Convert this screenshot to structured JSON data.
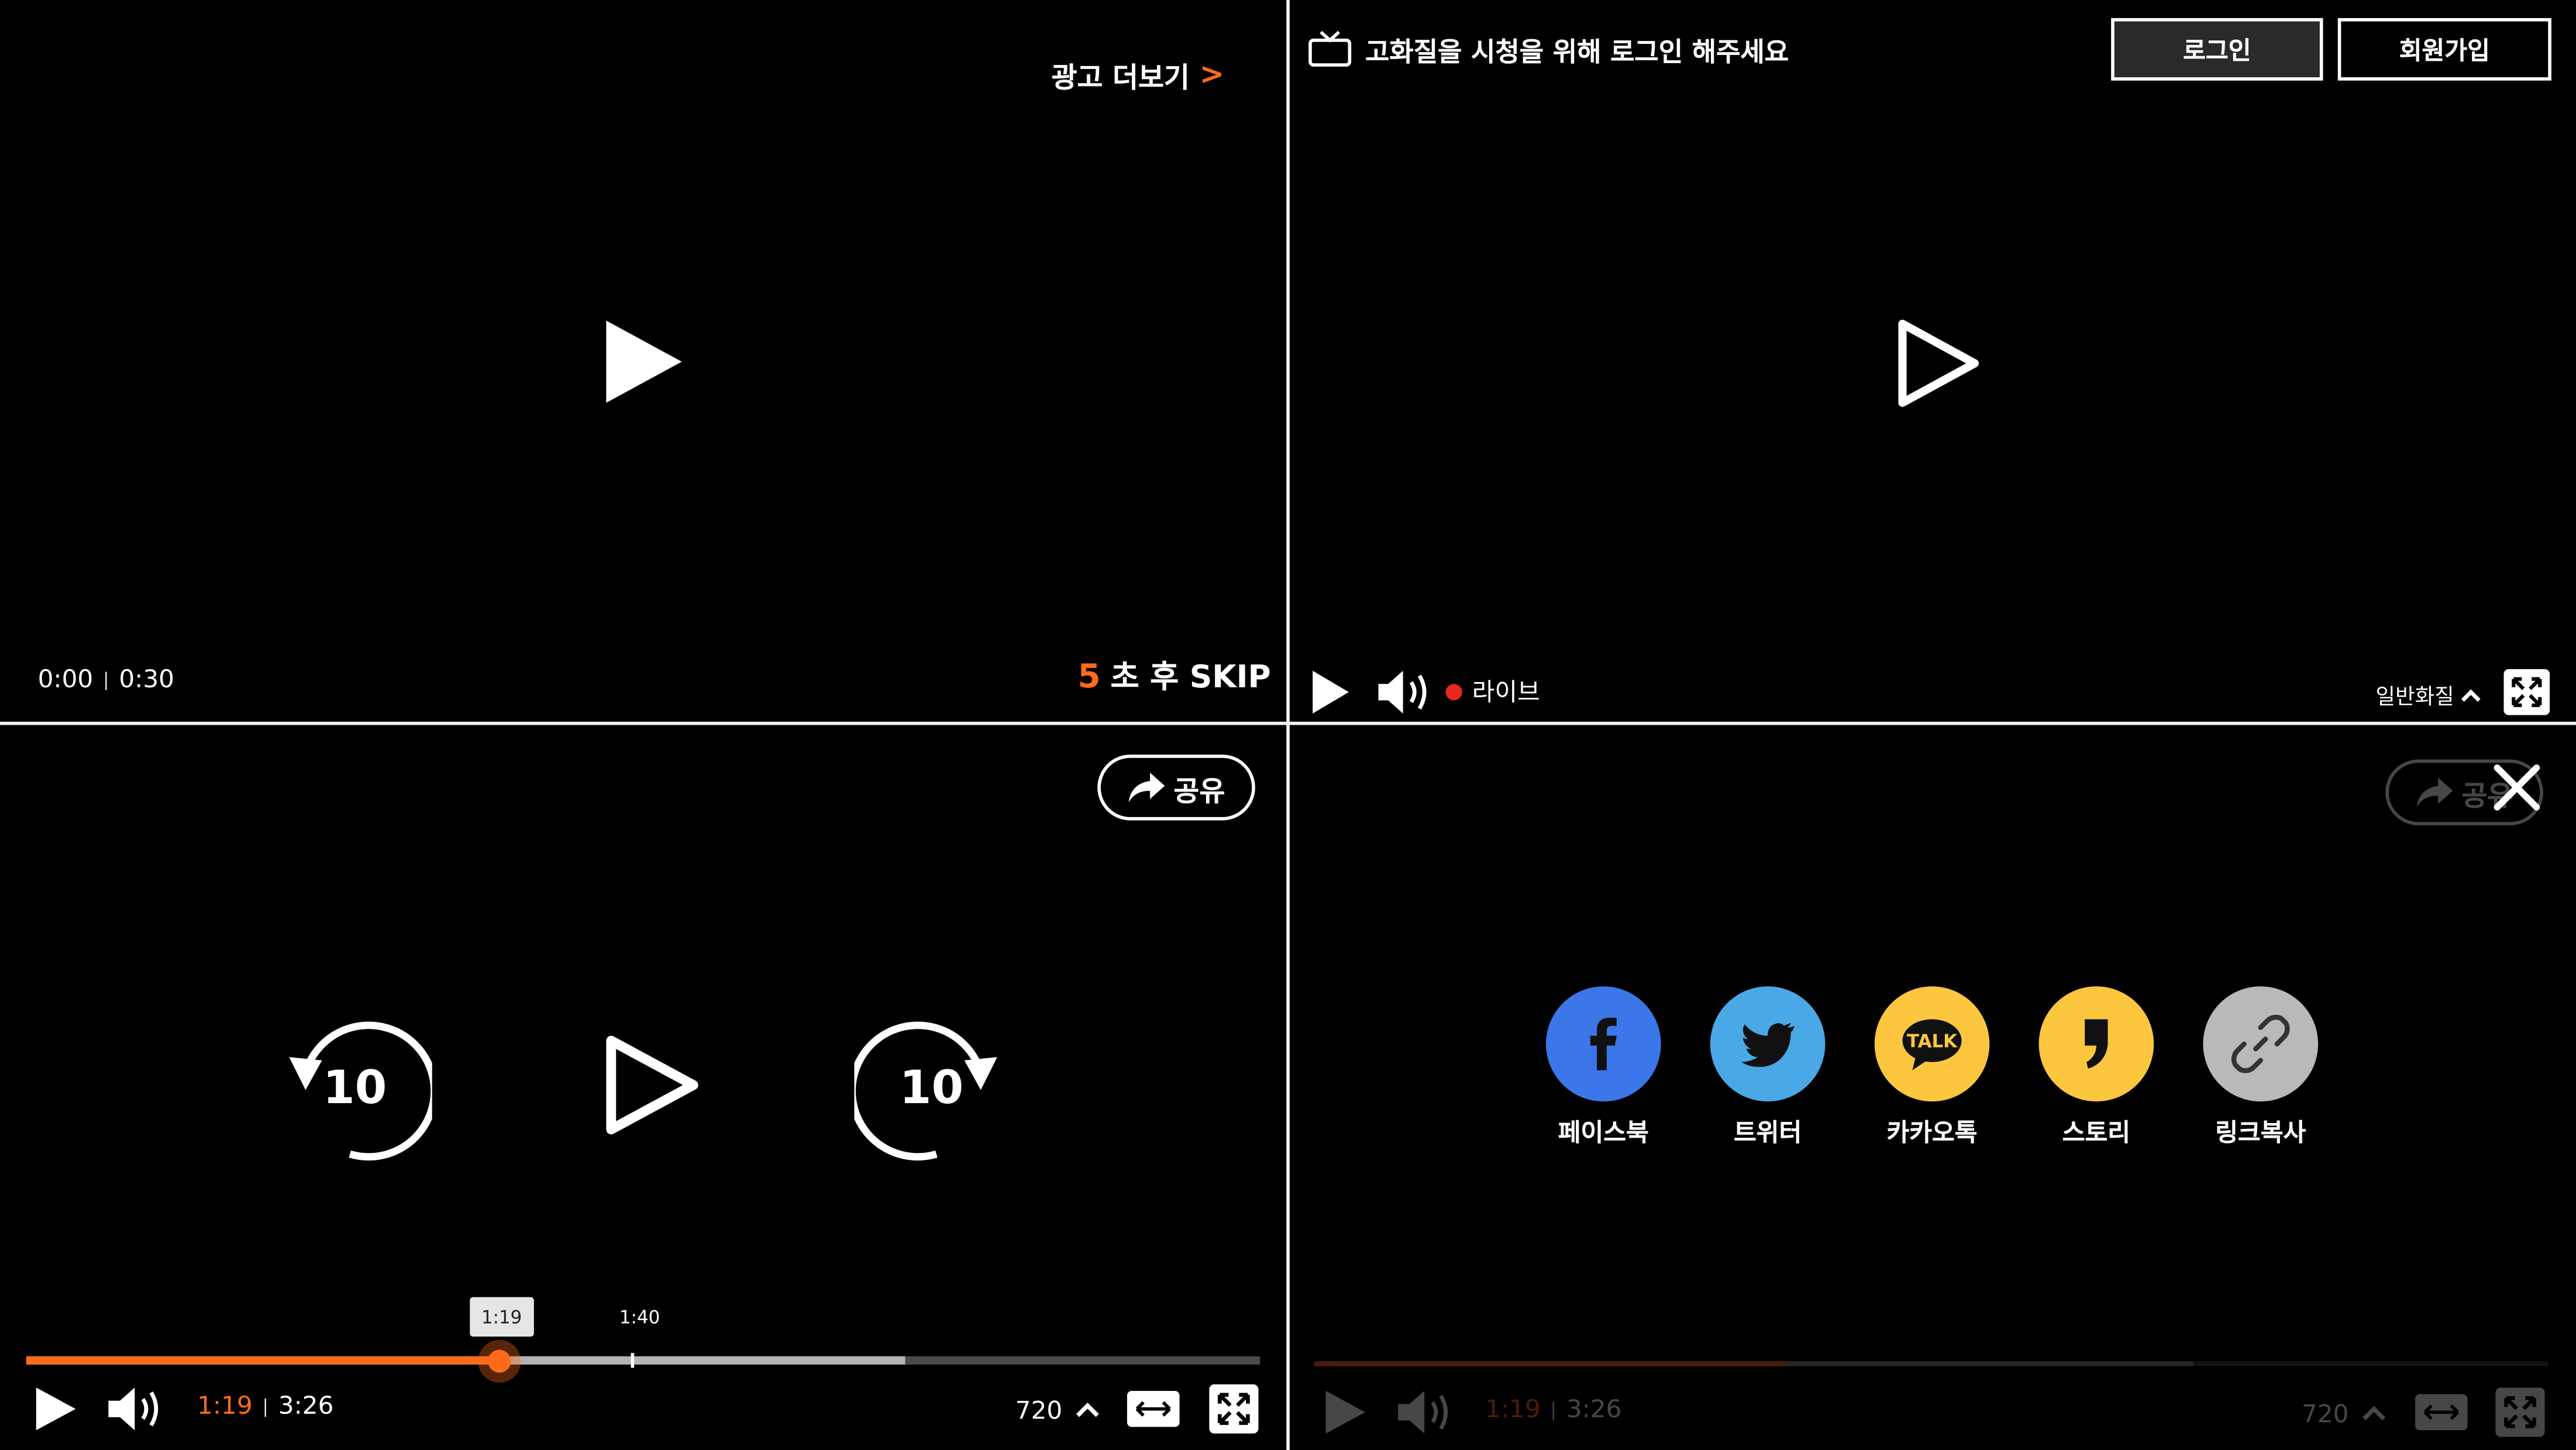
{
  "ad_panel": {
    "more_label": "광고 더보기",
    "more_chevron": ">",
    "time_current": "0:00",
    "time_sep": "|",
    "time_total": "0:30",
    "skip_count": "5",
    "skip_text": "초 후 SKIP"
  },
  "live_panel": {
    "login_message": "고화질을 시청을 위해 로그인 해주세요",
    "login_button": "로그인",
    "join_button": "회원가입",
    "live_label": "라이브",
    "quality_label": "일반화질"
  },
  "player_panel": {
    "share_label": "공유",
    "rewind_seconds": "10",
    "forward_seconds": "10",
    "tooltip_current": "1:19",
    "tooltip_hover": "1:40",
    "time_current": "1:19",
    "time_sep": "|",
    "time_total": "3:26",
    "quality": "720",
    "progress_fraction": 0.383,
    "buffer_fraction": 0.713,
    "hover_fraction": 0.49
  },
  "share_panel": {
    "share_label": "공유",
    "items": [
      {
        "label": "페이스북",
        "icon": "facebook-icon",
        "color": "#3b77e8"
      },
      {
        "label": "트위터",
        "icon": "twitter-icon",
        "color": "#4aa8e6"
      },
      {
        "label": "카카오톡",
        "icon": "kakaotalk-icon",
        "color": "#fdc63f"
      },
      {
        "label": "스토리",
        "icon": "kakaostory-icon",
        "color": "#fdc63f"
      },
      {
        "label": "링크복사",
        "icon": "link-icon",
        "color": "#b9b9b9"
      }
    ],
    "time_current": "1:19",
    "time_sep": "|",
    "time_total": "3:26",
    "quality": "720",
    "progress_fraction": 0.383,
    "buffer_fraction": 0.713
  },
  "colors": {
    "accent": "#ff6a1a",
    "live_dot": "#e8281f",
    "background": "#000000"
  }
}
